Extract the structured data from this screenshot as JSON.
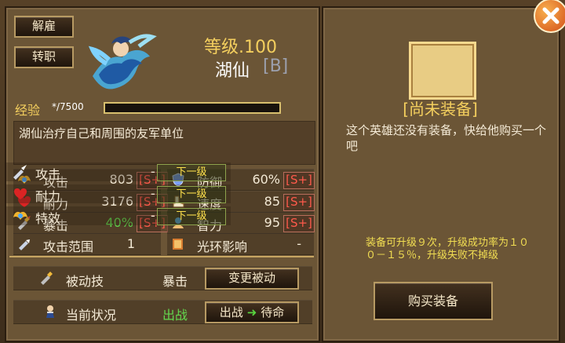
{
  "actions": {
    "dismiss": "解雇",
    "transfer": "转职"
  },
  "hero": {
    "level_text": "等级.100",
    "name": "湖仙",
    "rank": "[B]",
    "exp_label": "经验",
    "exp_value": "*/7500",
    "description": "湖仙治疗自己和周围的友军单位"
  },
  "stats": [
    {
      "label": "攻击",
      "value": "803",
      "grade": "[S+]",
      "icon": "wings-icon"
    },
    {
      "label": "防御",
      "value": "60%",
      "grade": "[S+]",
      "icon": "shield-icon"
    },
    {
      "label": "耐力",
      "value": "3176",
      "grade": "[S+]",
      "icon": "heart-icon"
    },
    {
      "label": "速度",
      "value": "85",
      "grade": "[S+]",
      "icon": "boot-icon"
    },
    {
      "label": "暴击",
      "value": "40%",
      "grade": "[S+]",
      "icon": "crit-icon"
    },
    {
      "label": "智力",
      "value": "95",
      "grade": "[S+]",
      "icon": "brain-icon"
    }
  ],
  "extra": {
    "attack_range_label": "攻击范围",
    "attack_range_value": "1",
    "aura_label": "光环影响",
    "aura_value": "-"
  },
  "passive": {
    "label": "被动技",
    "value": "暴击",
    "button": "变更被动"
  },
  "status": {
    "label": "当前状况",
    "value": "出战",
    "button_left": "出战",
    "button_right": "待命"
  },
  "equipment": {
    "title": "[尚未装备]",
    "message": "这个英雄还没有装备，快给他购买一个吧",
    "rows": [
      {
        "label": "攻击",
        "value": "-",
        "button": "下一级",
        "icon": "sword-icon"
      },
      {
        "label": "耐力",
        "value": "-",
        "button": "下一级",
        "icon": "heart-icon"
      },
      {
        "label": "特效",
        "value": "-",
        "button": "下一级",
        "icon": "wings-icon"
      }
    ],
    "upgrade_text": "装备可升级９次，升级成功率为１００－１５％，升级失败不掉级",
    "buy_button": "购买装备"
  },
  "close_icon": "close-icon"
}
